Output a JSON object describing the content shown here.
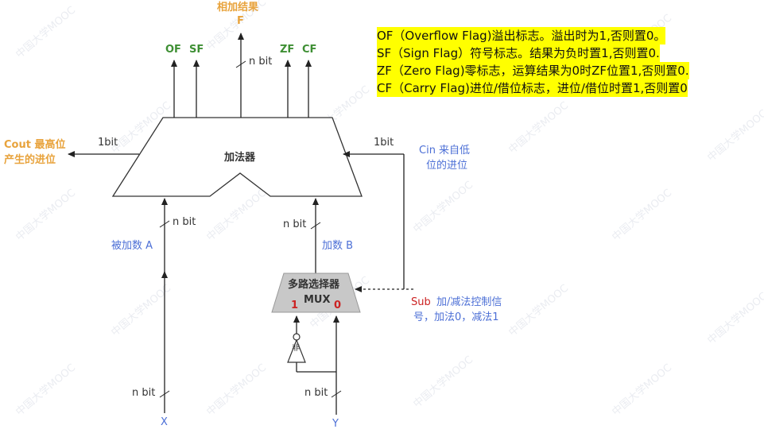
{
  "legend": {
    "of": "OF（Overflow Flag)溢出标志。溢出时为1,否则置0。",
    "sf": "SF（Sign Flag）符号标志。结果为负时置1,否则置0.",
    "zf": "ZF（Zero Flag)零标志，运算结果为0时ZF位置1,否则置0.",
    "cf": "CF（Carry Flag)进位/借位标志，进位/借位时置1,否则置0"
  },
  "adder": {
    "label": "加法器",
    "result_label": "相加结果",
    "result_symbol": "F",
    "result_width": "n bit",
    "flag_of": "OF",
    "flag_sf": "SF",
    "flag_zf": "ZF",
    "flag_cf": "CF"
  },
  "cout": {
    "label_line1": "Cout 最高位",
    "label_line2": "产生的进位",
    "width": "1bit"
  },
  "cin": {
    "label_line1": "Cin 来自低",
    "label_line2": "位的进位",
    "width": "1bit"
  },
  "operand_a": {
    "label": "被加数 A",
    "width": "n bit"
  },
  "operand_b": {
    "label": "加数 B",
    "width": "n bit"
  },
  "mux": {
    "label": "多路选择器",
    "sub_label": "MUX",
    "input_1": "1",
    "input_0": "0"
  },
  "sub": {
    "name": "Sub",
    "desc_line1": "加/减法控制信",
    "desc_line2": "号，加法0，减法1"
  },
  "inverter": {
    "symbol": "非"
  },
  "input_x": {
    "label": "X",
    "width": "n bit"
  },
  "input_y": {
    "label": "Y",
    "width": "n bit"
  },
  "watermark": {
    "text": "中国大学MOOC"
  },
  "colors": {
    "blue": "#4c6fd6",
    "orange": "#e8a33c",
    "green": "#3e8f34",
    "red": "#cc2222",
    "highlight": "#ffff00"
  }
}
